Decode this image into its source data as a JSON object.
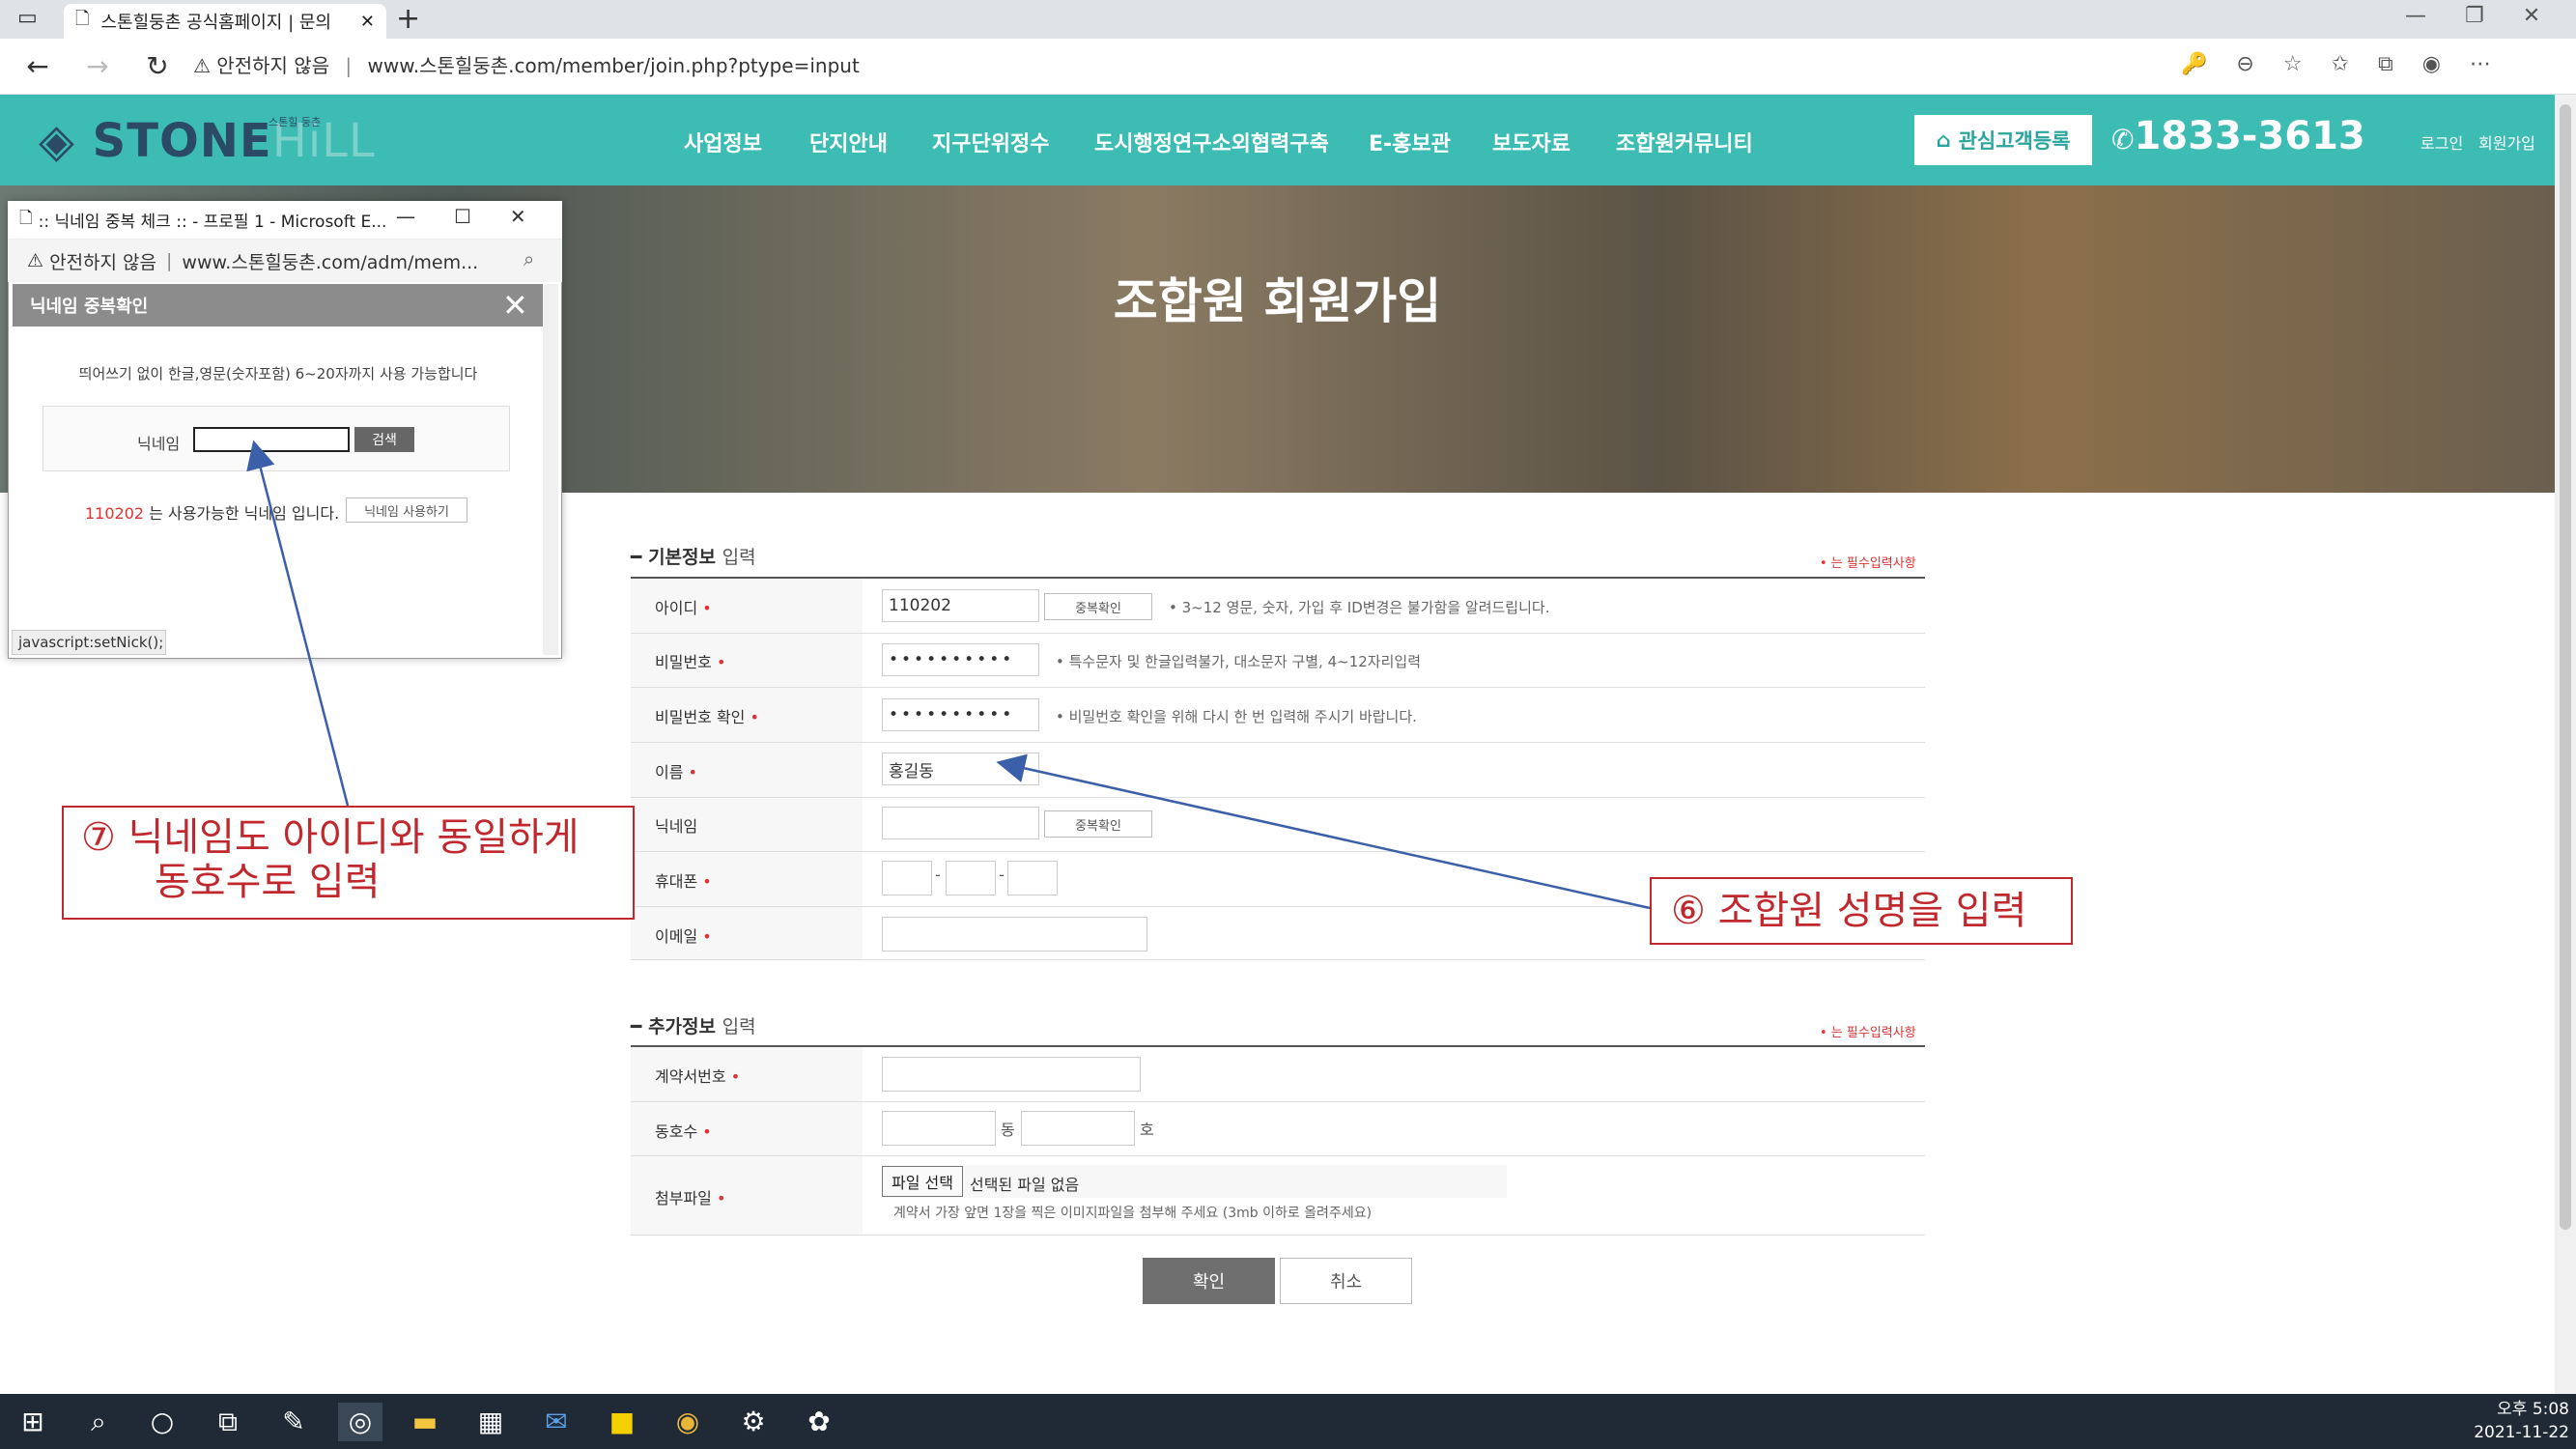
{
  "browser": {
    "tab_title": "스톤힐둥촌 공식홈페이지 | 문의",
    "tab_close": "✕",
    "new_tab": "+",
    "security_label": "안전하지 않음",
    "url": "www.스톤힐둥촌.com/member/join.php?ptype=input"
  },
  "site": {
    "logo_stone": "STONE",
    "logo_hill": "HiLL",
    "logo_small": "스톤힐 둥촌",
    "menu": [
      "사업정보",
      "단지안내",
      "지구단위정수",
      "도시행정연구소외협력구축",
      "E-홍보관",
      "보도자료",
      "조합원커뮤니티"
    ],
    "register_button": "관심고객등록",
    "phone": "1833-3613",
    "login": "로그인",
    "signup": "회원가입"
  },
  "hero": {
    "title": "조합원 회원가입"
  },
  "form": {
    "basic_section": {
      "title_bold": "기본정보",
      "title_rest": "입력",
      "required_note": "• 는 필수입력사항"
    },
    "fields": {
      "id": {
        "label": "아이디",
        "value": "110202",
        "check_button": "중복확인",
        "help": "• 3~12 영문, 숫자, 가입 후 ID변경은 불가함을 알려드립니다."
      },
      "password": {
        "label": "비밀번호",
        "value": "••••••••••",
        "help": "• 특수문자 및 한글입력불가, 대소문자 구별, 4~12자리입력"
      },
      "password_confirm": {
        "label": "비밀번호 확인",
        "value": "••••••••••",
        "help": "• 비밀번호 확인을 위해 다시 한 번 입력해 주시기 바랍니다."
      },
      "name": {
        "label": "이름",
        "value": "홍길동"
      },
      "nickname": {
        "label": "닉네임",
        "value": "",
        "check_button": "중복확인"
      },
      "phone": {
        "label": "휴대폰",
        "sep": "-"
      },
      "email": {
        "label": "이메일"
      }
    },
    "extra_section": {
      "title_bold": "추가정보",
      "title_rest": "입력",
      "required_note": "• 는 필수입력사항"
    },
    "extra_fields": {
      "contract": {
        "label": "계약서번호"
      },
      "unit": {
        "label": "동호수",
        "dong": "동",
        "ho": "호"
      },
      "attachment": {
        "label": "첨부파일",
        "file_button": "파일 선택",
        "file_status": "선택된 파일 없음",
        "help": "계약서 가장 앞면 1장을 찍은 이미지파일을 첨부해 주세요 (3mb 이하로 올려주세요)"
      }
    },
    "required_mark": "•",
    "confirm_button": "확인",
    "cancel_button": "취소"
  },
  "popup": {
    "window_title": ":: 닉네임 중복 체크 :: - 프로필 1 - Microsoft E...",
    "security_label": "안전하지 않음",
    "url": "www.스톤힐둥촌.com/adm/mem...",
    "header": "닉네임 중복확인",
    "info": "띄어쓰기 없이 한글,영문(숫자포함) 6~20자까지 사용 가능합니다",
    "nickname_label": "닉네임",
    "nickname_value": "",
    "search_button": "검색",
    "result_id": "110202",
    "result_text": "는 사용가능한 닉네임 입니다.",
    "use_button": "닉네임 사용하기",
    "status_bar": "javascript:setNick();"
  },
  "annotations": {
    "nickname_note_line1": "⑦ 닉네임도 아이디와 동일하게",
    "nickname_note_line2": "동호수로 입력",
    "name_note": "⑥ 조합원 성명을 입력"
  },
  "taskbar": {
    "clock_time": "오후 5:08",
    "clock_date": "2021-11-22"
  },
  "colors": {
    "brand": "#3dbcb4",
    "required": "#d33333",
    "annotation": "#c0282d",
    "arrow": "#3b5fa8"
  }
}
